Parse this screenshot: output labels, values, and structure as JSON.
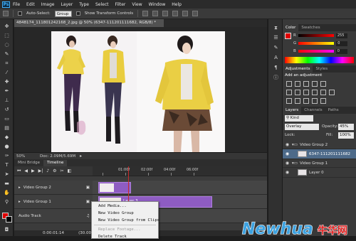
{
  "app": {
    "logo": "Ps"
  },
  "menu": [
    "File",
    "Edit",
    "Image",
    "Layer",
    "Type",
    "Select",
    "Filter",
    "View",
    "Window",
    "Help"
  ],
  "options": {
    "auto_select": "Auto-Select:",
    "select_value": "Group",
    "show_transform": "Show Transform Controls"
  },
  "document": {
    "tab_title": "4848174_111801242168_2.jpg @ 50% (6347-111201111682, RGB/8) *",
    "zoom": "50%",
    "doc_size": "Doc: 2.09M/5.69M"
  },
  "timeline": {
    "tabs": [
      "Mini Bridge",
      "Timeline"
    ],
    "ruler_labels": [
      "01:00f",
      "02:00f",
      "04:00f",
      "06:00f"
    ],
    "tracks": [
      {
        "name": "Video Group 2"
      },
      {
        "name": "Video Group 1"
      },
      {
        "name": "Audio Track"
      }
    ],
    "clip_label": "Layer 3",
    "current_time": "0:00:01:14",
    "fps": "(30.00 fps)"
  },
  "context_menu": {
    "items": [
      {
        "label": "Add Media...",
        "enabled": true
      },
      {
        "label": "New Video Group",
        "enabled": true
      },
      {
        "label": "New Video Group from Clips",
        "enabled": true
      },
      {
        "label": "Replace Footage...",
        "enabled": false
      },
      {
        "label": "Delete Track",
        "enabled": true
      }
    ]
  },
  "color_panel": {
    "tabs": [
      "Color",
      "Swatches"
    ],
    "channels": [
      {
        "label": "R",
        "value": "255",
        "gradient": "linear-gradient(90deg,#000,#ff0000)"
      },
      {
        "label": "G",
        "value": "0",
        "gradient": "linear-gradient(90deg,#ff0000,#ffff00)"
      },
      {
        "label": "B",
        "value": "0",
        "gradient": "linear-gradient(90deg,#ff0000,#ff00ff)"
      }
    ],
    "fg_color": "#e00000"
  },
  "adjustments_panel": {
    "tabs": [
      "Adjustments",
      "Styles"
    ],
    "title": "Add an adjustment"
  },
  "layers_panel": {
    "tabs": [
      "Layers",
      "Channels",
      "Paths"
    ],
    "kind_label": "Kind",
    "blend_mode": "Overlay",
    "opacity_label": "Opacity:",
    "opacity": "45%",
    "lock_label": "Lock:",
    "fill_label": "Fill:",
    "fill": "100%",
    "layers": [
      {
        "name": "Video Group 2",
        "type": "group",
        "selected": false
      },
      {
        "name": "6347-111201111682",
        "type": "layer",
        "selected": true
      },
      {
        "name": "Video Group 1",
        "type": "group",
        "selected": false
      },
      {
        "name": "Layer 0",
        "type": "layer",
        "selected": false
      }
    ]
  },
  "watermark": {
    "text1": "Newhua",
    "text2": "牛华网"
  }
}
